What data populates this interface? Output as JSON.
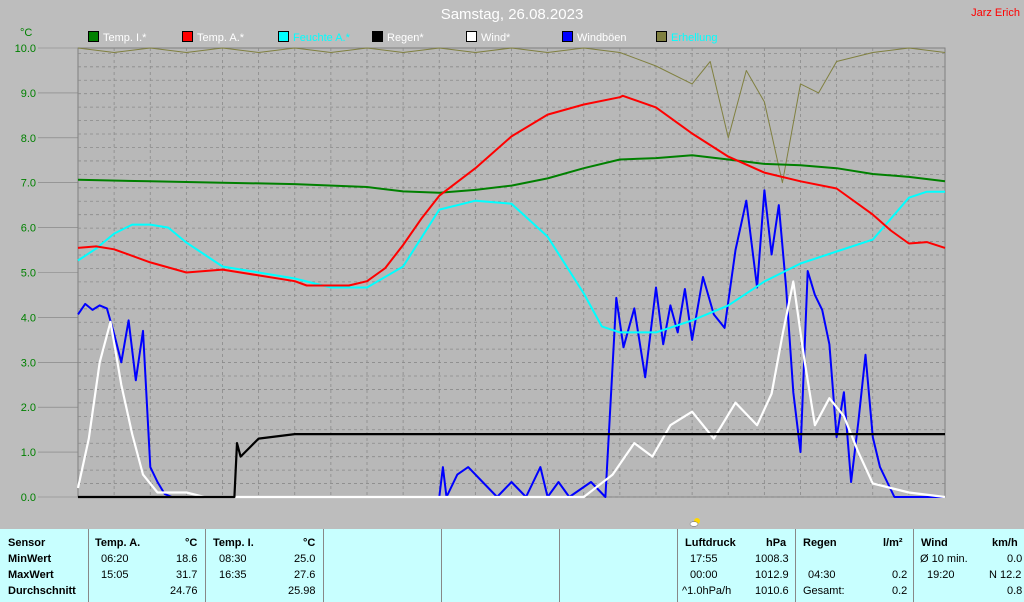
{
  "page": {
    "title": "Samstag, 26.08.2023",
    "author": "Jarz Erich",
    "unit_label": "°C"
  },
  "legend": [
    {
      "label": "Temp. I.*",
      "color": "#008000",
      "text_color": "#ffffff"
    },
    {
      "label": "Temp. A.*",
      "color": "#ff0000",
      "text_color": "#ffffff"
    },
    {
      "label": "Feuchte A.*",
      "color": "#00ffff",
      "text_color": "#00ffff"
    },
    {
      "label": "Regen*",
      "color": "#000000",
      "text_color": "#ffffff"
    },
    {
      "label": "Wind*",
      "color": "#ffffff",
      "text_color": "#ffffff"
    },
    {
      "label": "Windböen",
      "color": "#0000ff",
      "text_color": "#ffffff"
    },
    {
      "label": "Erhellung",
      "color": "#808040",
      "text_color": "#00ffff"
    }
  ],
  "chart_data": {
    "type": "line",
    "title": "Samstag, 26.08.2023",
    "x_range": [
      "00:00",
      "24:00"
    ],
    "y_ticks": [
      "0.0",
      "1.0",
      "2.0",
      "3.0",
      "4.0",
      "5.0",
      "6.0",
      "7.0",
      "8.0",
      "9.0",
      "10.0"
    ],
    "ylim": [
      0,
      10
    ],
    "grid": true,
    "legend_position": "top",
    "series": [
      {
        "name": "Temp. I.*",
        "color": "#008000",
        "x_hours": [
          0,
          2,
          4,
          6,
          8,
          9,
          10,
          11,
          12,
          13,
          14,
          15,
          16,
          17,
          18,
          19,
          20,
          21,
          22,
          23,
          24
        ],
        "values": [
          25.9,
          25.8,
          25.7,
          25.6,
          25.4,
          25.1,
          25.0,
          25.2,
          25.5,
          26.0,
          26.7,
          27.3,
          27.4,
          27.6,
          27.3,
          27.0,
          26.9,
          26.7,
          26.3,
          26.1,
          25.8
        ]
      },
      {
        "name": "Temp. A.*",
        "color": "#ff0000",
        "x_hours": [
          0,
          0.5,
          1,
          2,
          3,
          4,
          5,
          6,
          6.33,
          7,
          7.5,
          8,
          8.5,
          9,
          9.5,
          10,
          11,
          12,
          13,
          14,
          15,
          15.08,
          16,
          17,
          18,
          19,
          20,
          21,
          22,
          22.5,
          23,
          23.5,
          24
        ],
        "values": [
          21.2,
          21.3,
          21.1,
          20.2,
          19.5,
          19.7,
          19.3,
          18.9,
          18.6,
          18.6,
          18.6,
          18.9,
          19.8,
          21.4,
          23.2,
          24.8,
          26.7,
          28.9,
          30.4,
          31.1,
          31.6,
          31.7,
          30.9,
          29.1,
          27.5,
          26.4,
          25.8,
          25.3,
          23.5,
          22.4,
          21.5,
          21.6,
          21.2
        ]
      },
      {
        "name": "Feuchte A.*",
        "color": "#00ffff",
        "x_hours": [
          0,
          0.5,
          1,
          1.5,
          2,
          2.5,
          3,
          3.5,
          4,
          5,
          6,
          7,
          8,
          9,
          10,
          11,
          12,
          13,
          14,
          14.5,
          15,
          16,
          17,
          18,
          19,
          20,
          21,
          22,
          23,
          23.5,
          24
        ],
        "values": [
          49,
          53,
          58,
          61,
          61,
          60,
          55,
          51,
          47,
          45,
          43,
          40,
          40,
          47,
          66,
          69,
          68,
          57,
          38,
          27,
          25,
          25,
          29,
          34,
          42,
          48,
          52,
          56,
          70,
          72,
          72
        ]
      },
      {
        "name": "Regen*",
        "color": "#000000",
        "x_hours": [
          0,
          4.33,
          4.4,
          4.5,
          4.75,
          5,
          6,
          12,
          24
        ],
        "values": [
          0,
          0,
          1.2,
          0.9,
          1.1,
          1.3,
          1.4,
          1.4,
          1.4
        ]
      },
      {
        "name": "Wind*",
        "color": "#ffffff",
        "x_hours": [
          0,
          0.3,
          0.6,
          0.9,
          1.2,
          1.5,
          1.8,
          2.2,
          2.6,
          3.0,
          3.5,
          4.0,
          14.0,
          14.8,
          15.4,
          15.9,
          16.4,
          17.0,
          17.6,
          18.2,
          18.8,
          19.2,
          19.5,
          19.8,
          20.1,
          20.4,
          20.8,
          21.2,
          21.6,
          22.0,
          22.5,
          23.0,
          24.0
        ],
        "values": [
          0.2,
          1.3,
          3.0,
          3.9,
          2.5,
          1.4,
          0.5,
          0.1,
          0.1,
          0.1,
          0,
          0,
          0,
          0.5,
          1.2,
          0.9,
          1.6,
          1.9,
          1.3,
          2.1,
          1.6,
          2.3,
          3.6,
          4.8,
          3.1,
          1.6,
          2.2,
          1.8,
          1.0,
          0.3,
          0.2,
          0.1,
          0
        ]
      },
      {
        "name": "Windböen",
        "color": "#0000ff",
        "x_hours": [
          0,
          0.2,
          0.4,
          0.6,
          0.8,
          1.0,
          1.2,
          1.4,
          1.6,
          1.8,
          2.0,
          2.2,
          2.4,
          2.6,
          2.8,
          3.0,
          3.2,
          10.0,
          10.1,
          10.2,
          10.5,
          10.8,
          11.2,
          11.6,
          12.0,
          12.4,
          12.8,
          13.0,
          13.3,
          13.6,
          14.2,
          14.6,
          14.9,
          15.1,
          15.4,
          15.7,
          16.0,
          16.2,
          16.4,
          16.6,
          16.8,
          17.0,
          17.3,
          17.6,
          17.9,
          18.2,
          18.5,
          18.8,
          19.0,
          19.2,
          19.4,
          19.6,
          19.8,
          20.0,
          20.2,
          20.4,
          20.6,
          20.8,
          21.0,
          21.2,
          21.4,
          21.6,
          21.8,
          22.0,
          22.2,
          22.4,
          22.6,
          24.0
        ],
        "values": [
          12.2,
          12.9,
          12.5,
          12.8,
          12.6,
          10.9,
          9.0,
          11.8,
          7.8,
          11.1,
          2.0,
          1.0,
          0.2,
          0,
          0,
          0,
          0,
          0,
          2.0,
          0,
          1.5,
          2.0,
          1.0,
          0,
          1.0,
          0,
          2.0,
          0,
          1.0,
          0,
          1.0,
          0,
          13.3,
          10.0,
          12.6,
          8.0,
          14.0,
          10.2,
          12.8,
          11.0,
          13.9,
          10.5,
          14.7,
          12.2,
          11.3,
          16.5,
          19.8,
          14.0,
          20.5,
          16.2,
          19.5,
          14.0,
          7.0,
          3.0,
          15.1,
          13.5,
          12.5,
          10.2,
          4.0,
          7.0,
          1.0,
          5.0,
          9.5,
          4.0,
          2.0,
          1.0,
          0,
          0
        ]
      },
      {
        "name": "Erhellung",
        "color": "#808040",
        "x_hours": [
          0,
          1,
          2,
          3,
          4,
          5,
          6,
          7,
          8,
          9,
          10,
          11,
          12,
          13,
          14,
          15,
          16,
          17,
          17.5,
          18,
          18.5,
          19,
          19.5,
          20,
          20.5,
          21,
          22,
          23,
          24
        ],
        "values": [
          100,
          99,
          100,
          99,
          100,
          99,
          100,
          99,
          100,
          99,
          100,
          99,
          100,
          99,
          100,
          99,
          96,
          92,
          97,
          80,
          95,
          88,
          70,
          92,
          90,
          97,
          99,
          100,
          99
        ]
      }
    ]
  },
  "stats": {
    "headers": {
      "sensor": "Sensor",
      "temp_a": "Temp. A.",
      "temp_i": "Temp. I.",
      "luftdruck": "Luftdruck",
      "regen": "Regen",
      "wind": "Wind"
    },
    "units": {
      "temp_a": "°C",
      "temp_i": "°C",
      "luftdruck": "hPa",
      "regen": "l/m²",
      "wind": "km/h"
    },
    "row_labels": [
      "MinWert",
      "MaxWert",
      "Durchschnitt"
    ],
    "temp_a": {
      "min_time": "06:20",
      "min_value": "18.6",
      "max_time": "15:05",
      "max_value": "31.7",
      "avg_value": "24.76"
    },
    "temp_i": {
      "min_time": "08:30",
      "min_value": "25.0",
      "max_time": "16:35",
      "max_value": "27.6",
      "avg_value": "25.98"
    },
    "luftdruck": {
      "min_time": "17:55",
      "min_value": "1008.3",
      "max_time": "00:00",
      "max_value": "1012.9",
      "trend_label": "^1.0hPa/h",
      "trend_value": "1010.6"
    },
    "regen": {
      "max_time": "04:30",
      "max_value": "0.2",
      "total_label": "Gesamt:",
      "total_value": "0.2"
    },
    "wind": {
      "avg_label": "Ø 10 min.",
      "avg_value": "0.0",
      "max_time": "19:20",
      "max_value": "N 12.2",
      "mean_value": "0.8"
    }
  }
}
